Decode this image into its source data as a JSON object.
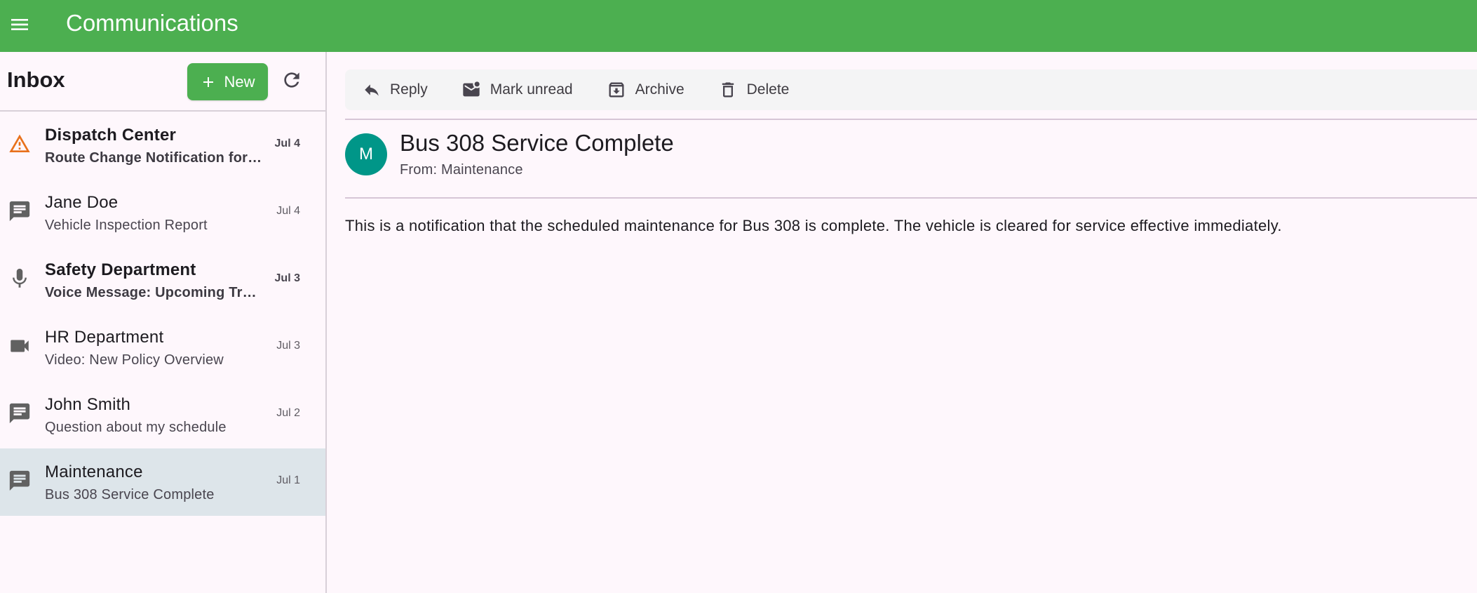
{
  "appbar": {
    "title": "Communications",
    "menu_icon": "menu-icon",
    "color": "#4caf50"
  },
  "sidebar": {
    "title": "Inbox",
    "new_button_label": "New",
    "refresh_icon": "refresh-icon",
    "messages": [
      {
        "sender": "Dispatch Center",
        "subject": "Route Change Notification for …",
        "date": "Jul 4",
        "icon": "warning-icon",
        "unread": true,
        "selected": false
      },
      {
        "sender": "Jane Doe",
        "subject": "Vehicle Inspection Report",
        "date": "Jul 4",
        "icon": "chat-icon",
        "unread": false,
        "selected": false
      },
      {
        "sender": "Safety Department",
        "subject": "Voice Message: Upcoming Tra…",
        "date": "Jul 3",
        "icon": "microphone-icon",
        "unread": true,
        "selected": false
      },
      {
        "sender": "HR Department",
        "subject": "Video: New Policy Overview",
        "date": "Jul 3",
        "icon": "videocam-icon",
        "unread": false,
        "selected": false
      },
      {
        "sender": "John Smith",
        "subject": "Question about my schedule",
        "date": "Jul 2",
        "icon": "chat-icon",
        "unread": false,
        "selected": false
      },
      {
        "sender": "Maintenance",
        "subject": "Bus 308 Service Complete",
        "date": "Jul 1",
        "icon": "chat-icon",
        "unread": false,
        "selected": true
      }
    ]
  },
  "toolbar": {
    "reply_label": "Reply",
    "mark_unread_label": "Mark unread",
    "archive_label": "Archive",
    "delete_label": "Delete"
  },
  "detail": {
    "avatar_letter": "M",
    "avatar_color": "#009688",
    "title": "Bus 308 Service Complete",
    "from": "From: Maintenance",
    "body": "This is a notification that the scheduled maintenance for Bus 308 is complete. The vehicle is cleared for service effective immediately."
  },
  "colors": {
    "warning": "#e8711c",
    "icon_gray": "#616161",
    "selected_row": "#dde5ea"
  }
}
